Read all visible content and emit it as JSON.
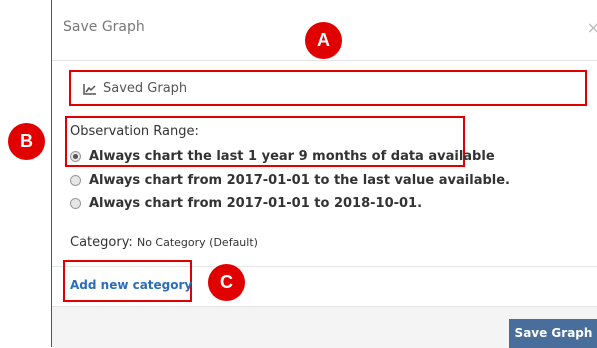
{
  "dialog": {
    "title": "Save Graph",
    "close_label": "×"
  },
  "graph_name": {
    "icon": "line-chart-icon",
    "value": "Saved Graph"
  },
  "observation_range": {
    "label": "Observation Range:",
    "options": [
      {
        "label": "Always chart the last 1 year 9 months of data available",
        "selected": true
      },
      {
        "label": "Always chart from 2017-01-01 to the last value available.",
        "selected": false
      },
      {
        "label": "Always chart from 2017-01-01 to 2018-10-01.",
        "selected": false
      }
    ]
  },
  "category": {
    "label": "Category:",
    "value": "No Category (Default)"
  },
  "add_category_label": "Add new category",
  "save_button_label": "Save Graph",
  "callouts": {
    "a": "A",
    "b": "B",
    "c": "C",
    "color": "#e00000"
  }
}
